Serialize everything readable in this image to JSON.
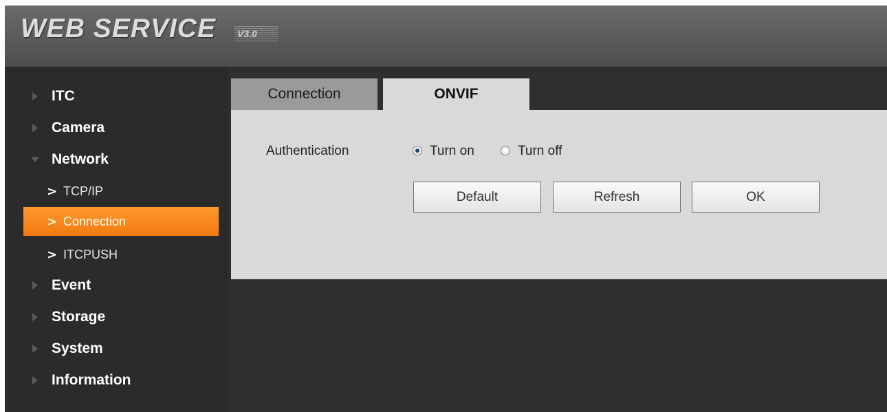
{
  "header": {
    "logo_text": "WEB  SERVICE",
    "version": "V3.0"
  },
  "sidebar": {
    "items": [
      {
        "label": "ITC",
        "icon": "triangle-right-icon"
      },
      {
        "label": "Camera",
        "icon": "triangle-right-icon"
      },
      {
        "label": "Network",
        "icon": "triangle-down-icon",
        "expanded": true,
        "children": [
          {
            "label": "TCP/IP"
          },
          {
            "label": "Connection",
            "active": true
          },
          {
            "label": "ITCPUSH"
          }
        ]
      },
      {
        "label": "Event",
        "icon": "triangle-right-icon"
      },
      {
        "label": "Storage",
        "icon": "triangle-right-icon"
      },
      {
        "label": "System",
        "icon": "triangle-right-icon"
      },
      {
        "label": "Information",
        "icon": "triangle-right-icon"
      }
    ],
    "active_color": "#f58a1f"
  },
  "tabs": [
    {
      "label": "Connection",
      "active": false
    },
    {
      "label": "ONVIF",
      "active": true
    }
  ],
  "form": {
    "auth_label": "Authentication",
    "radio_on_label": "Turn on",
    "radio_off_label": "Turn off",
    "selected": "Turn on"
  },
  "buttons": {
    "default_label": "Default",
    "refresh_label": "Refresh",
    "ok_label": "OK"
  }
}
